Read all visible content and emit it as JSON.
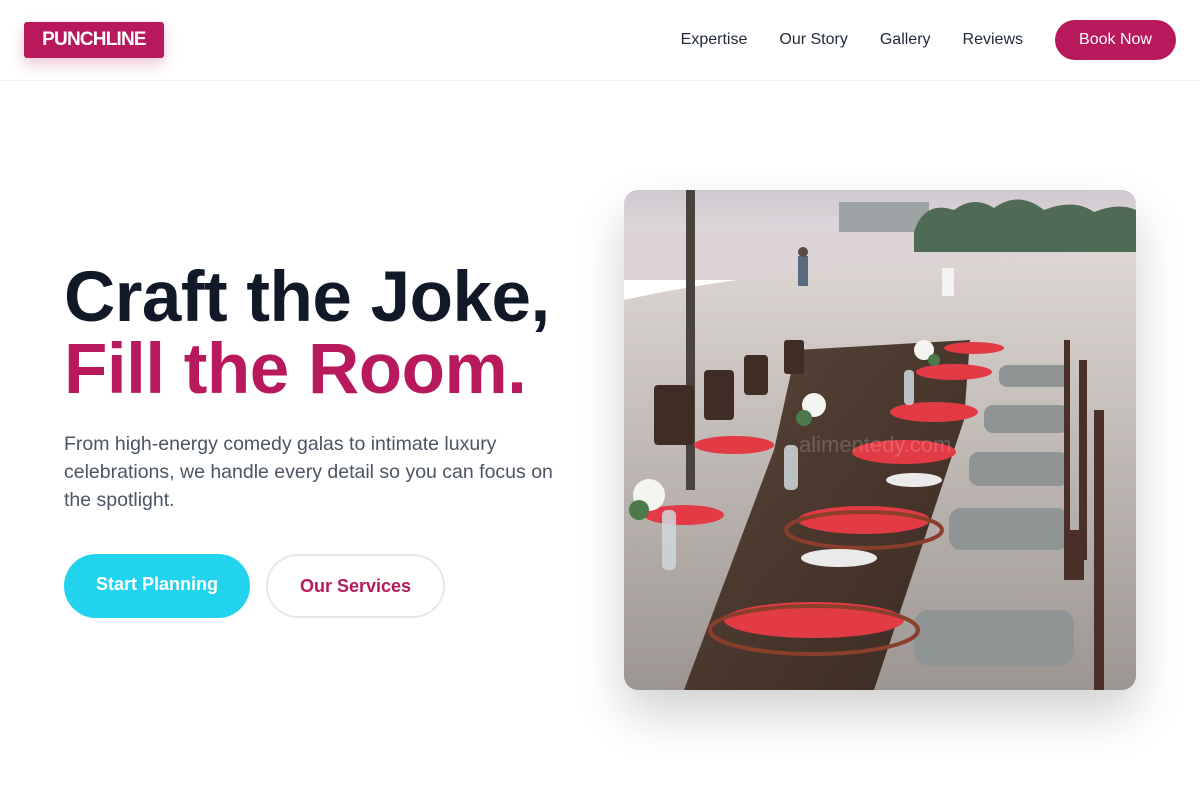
{
  "header": {
    "logo": "PUNCHLINE",
    "nav": [
      "Expertise",
      "Our Story",
      "Gallery",
      "Reviews"
    ],
    "cta": "Book Now"
  },
  "hero": {
    "title_line1": "Craft the Joke,",
    "title_line2": "Fill the Room.",
    "description": "From high-energy comedy galas to intimate luxury celebrations, we handle every detail so you can focus on the spotlight.",
    "primary_button": "Start Planning",
    "secondary_button": "Our Services",
    "image_watermark": "alimentedy.com"
  },
  "colors": {
    "brand": "#b8185c",
    "accent": "#22d3ee",
    "heading": "#111827",
    "body_text": "#4b5563"
  }
}
